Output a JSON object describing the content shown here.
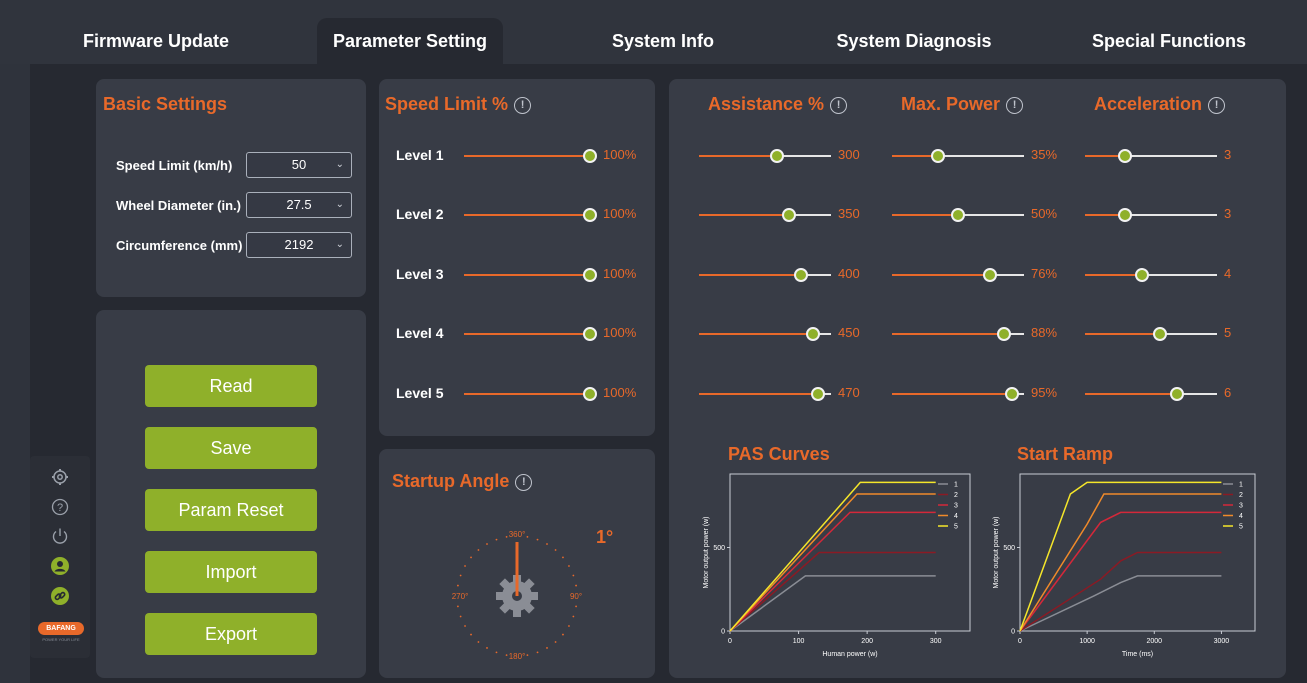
{
  "tabs": [
    {
      "label": "Firmware Update"
    },
    {
      "label": "Parameter Setting"
    },
    {
      "label": "System Info"
    },
    {
      "label": "System Diagnosis"
    },
    {
      "label": "Special Functions"
    }
  ],
  "basic_settings": {
    "title": "Basic Settings",
    "fields": [
      {
        "label": "Speed Limit (km/h)",
        "value": "50"
      },
      {
        "label": "Wheel Diameter (in.)",
        "value": "27.5"
      },
      {
        "label": "Circumference (mm)",
        "value": "2192"
      }
    ]
  },
  "actions": {
    "read": "Read",
    "save": "Save",
    "reset": "Param Reset",
    "import": "Import",
    "export": "Export"
  },
  "speed_limit": {
    "title": "Speed Limit %",
    "levels": [
      {
        "label": "Level 1",
        "value": "100%",
        "fraction": 1.0
      },
      {
        "label": "Level 2",
        "value": "100%",
        "fraction": 1.0
      },
      {
        "label": "Level 3",
        "value": "100%",
        "fraction": 1.0
      },
      {
        "label": "Level 4",
        "value": "100%",
        "fraction": 1.0
      },
      {
        "label": "Level 5",
        "value": "100%",
        "fraction": 1.0
      }
    ]
  },
  "assistance": {
    "title": "Assistance %",
    "values": [
      {
        "value": "300",
        "fraction": 0.59
      },
      {
        "value": "350",
        "fraction": 0.68
      },
      {
        "value": "400",
        "fraction": 0.77
      },
      {
        "value": "450",
        "fraction": 0.86
      },
      {
        "value": "470",
        "fraction": 0.9
      }
    ]
  },
  "max_power": {
    "title": "Max. Power",
    "values": [
      {
        "value": "35%",
        "fraction": 0.35
      },
      {
        "value": "50%",
        "fraction": 0.5
      },
      {
        "value": "76%",
        "fraction": 0.74
      },
      {
        "value": "88%",
        "fraction": 0.85
      },
      {
        "value": "95%",
        "fraction": 0.91
      }
    ]
  },
  "acceleration": {
    "title": "Acceleration",
    "values": [
      {
        "value": "3",
        "fraction": 0.3
      },
      {
        "value": "3",
        "fraction": 0.3
      },
      {
        "value": "4",
        "fraction": 0.43
      },
      {
        "value": "5",
        "fraction": 0.57
      },
      {
        "value": "6",
        "fraction": 0.7
      }
    ]
  },
  "startup_angle": {
    "title": "Startup Angle",
    "value": "1°",
    "dial": {
      "top": "360°",
      "right": "90°",
      "bottom": "180°",
      "left": "270°"
    }
  },
  "sidebar": {
    "icons": [
      "gear-icon",
      "help-icon",
      "power-icon",
      "user-icon",
      "link-icon"
    ],
    "logo_text": "BAFANG",
    "logo_tagline": "POWER YOUR LIFE"
  },
  "colors": {
    "accent": "#e8692a",
    "button": "#8fb02a",
    "series": [
      "#8a8d95",
      "#8b1a24",
      "#d4283a",
      "#f08a2a",
      "#f5e62a"
    ]
  },
  "chart_data": [
    {
      "type": "line",
      "title": "PAS Curves",
      "xlabel": "Human power (w)",
      "ylabel": "Motor output power (w)",
      "xlim": [
        0,
        350
      ],
      "ylim": [
        0,
        940
      ],
      "xticks": [
        0,
        100,
        200,
        300
      ],
      "yticks": [
        0,
        500
      ],
      "series": [
        {
          "name": "1",
          "points": [
            [
              0,
              0
            ],
            [
              110,
              330
            ],
            [
              300,
              330
            ]
          ]
        },
        {
          "name": "2",
          "points": [
            [
              0,
              0
            ],
            [
              130,
              470
            ],
            [
              300,
              470
            ]
          ]
        },
        {
          "name": "3",
          "points": [
            [
              0,
              0
            ],
            [
              175,
              710
            ],
            [
              300,
              710
            ]
          ]
        },
        {
          "name": "4",
          "points": [
            [
              0,
              0
            ],
            [
              185,
              820
            ],
            [
              300,
              820
            ]
          ]
        },
        {
          "name": "5",
          "points": [
            [
              0,
              0
            ],
            [
              190,
              890
            ],
            [
              300,
              890
            ]
          ]
        }
      ]
    },
    {
      "type": "line",
      "title": "Start Ramp",
      "xlabel": "Time (ms)",
      "ylabel": "Motor output power (w)",
      "xlim": [
        0,
        3500
      ],
      "ylim": [
        0,
        940
      ],
      "xticks": [
        0,
        1000,
        2000,
        3000
      ],
      "yticks": [
        0,
        500
      ],
      "series": [
        {
          "name": "1",
          "points": [
            [
              0,
              0
            ],
            [
              1100,
              210
            ],
            [
              1500,
              290
            ],
            [
              1750,
              330
            ],
            [
              3000,
              330
            ]
          ]
        },
        {
          "name": "2",
          "points": [
            [
              0,
              0
            ],
            [
              1200,
              310
            ],
            [
              1500,
              420
            ],
            [
              1750,
              470
            ],
            [
              3000,
              470
            ]
          ]
        },
        {
          "name": "3",
          "points": [
            [
              0,
              0
            ],
            [
              1200,
              650
            ],
            [
              1500,
              710
            ],
            [
              3000,
              710
            ]
          ]
        },
        {
          "name": "4",
          "points": [
            [
              0,
              0
            ],
            [
              1000,
              640
            ],
            [
              1250,
              820
            ],
            [
              3000,
              820
            ]
          ]
        },
        {
          "name": "5",
          "points": [
            [
              0,
              0
            ],
            [
              750,
              820
            ],
            [
              1000,
              890
            ],
            [
              3000,
              890
            ]
          ]
        }
      ]
    }
  ]
}
